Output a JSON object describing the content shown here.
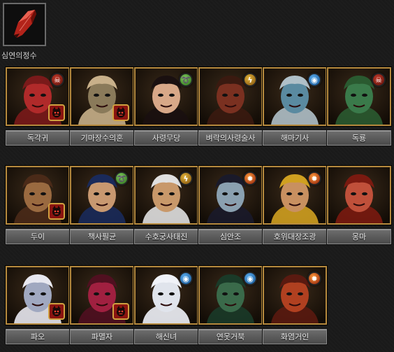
{
  "item": {
    "label": "심연의정수",
    "icon": "red-crystal-icon"
  },
  "colors": {
    "frame": "#b68a3e",
    "button": "#5a5a5a",
    "background": "#1a1a1a"
  },
  "rows": [
    [
      {
        "name": "독각귀",
        "element": "dark",
        "element_icon": "dark-element-icon",
        "enhanced": true,
        "hue": "#b02a2a",
        "hair": "#7a1a1a"
      },
      {
        "name": "기마장수의혼",
        "element": "",
        "element_icon": "",
        "enhanced": true,
        "hue": "#8a7a5a",
        "hair": "#c8b08a"
      },
      {
        "name": "사령무당",
        "element": "wind",
        "element_icon": "wind-element-icon",
        "enhanced": false,
        "hue": "#d8a888",
        "hair": "#1a1010"
      },
      {
        "name": "벼락의사령술사",
        "element": "lightning",
        "element_icon": "lightning-element-icon",
        "enhanced": false,
        "hue": "#7a3020",
        "hair": "#3a1a10"
      },
      {
        "name": "해마기사",
        "element": "water",
        "element_icon": "water-element-icon",
        "enhanced": false,
        "hue": "#5a8aa0",
        "hair": "#b0c0c8"
      },
      {
        "name": "독룡",
        "element": "dark",
        "element_icon": "dark-element-icon",
        "enhanced": false,
        "hue": "#3a7a4a",
        "hair": "#2a5a30"
      }
    ],
    [
      {
        "name": "두이",
        "element": "",
        "element_icon": "",
        "enhanced": true,
        "hue": "#9a6a40",
        "hair": "#4a2a18"
      },
      {
        "name": "책사필균",
        "element": "wind",
        "element_icon": "wind-element-icon",
        "enhanced": false,
        "hue": "#c89870",
        "hair": "#1a2a5a"
      },
      {
        "name": "수호궁사태진",
        "element": "lightning",
        "element_icon": "lightning-element-icon",
        "enhanced": false,
        "hue": "#c8986a",
        "hair": "#e0e0e0"
      },
      {
        "name": "심안조",
        "element": "fire",
        "element_icon": "fire-element-icon",
        "enhanced": false,
        "hue": "#8aa0b0",
        "hair": "#1a1a2a"
      },
      {
        "name": "호위대장조광",
        "element": "fire",
        "element_icon": "fire-element-icon",
        "enhanced": false,
        "hue": "#c89060",
        "hair": "#d0a020"
      },
      {
        "name": "몽마",
        "element": "",
        "element_icon": "",
        "enhanced": false,
        "hue": "#c0503a",
        "hair": "#7a1a10"
      }
    ],
    [
      {
        "name": "파오",
        "element": "",
        "element_icon": "",
        "enhanced": true,
        "hue": "#a0a8c0",
        "hair": "#e8e8f0"
      },
      {
        "name": "파멸자",
        "element": "",
        "element_icon": "",
        "enhanced": true,
        "hue": "#a02040",
        "hair": "#501020"
      },
      {
        "name": "해신녀",
        "element": "water",
        "element_icon": "water-element-icon",
        "enhanced": false,
        "hue": "#e0e4ec",
        "hair": "#f0f2f8"
      },
      {
        "name": "연못거북",
        "element": "water",
        "element_icon": "water-element-icon",
        "enhanced": false,
        "hue": "#3a6a4a",
        "hair": "#1a3a28"
      },
      {
        "name": "화염거인",
        "element": "fire",
        "element_icon": "fire-element-icon",
        "enhanced": false,
        "hue": "#b04020",
        "hair": "#5a1a10"
      }
    ]
  ]
}
